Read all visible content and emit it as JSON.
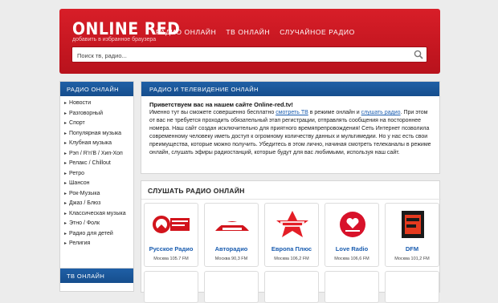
{
  "header": {
    "logo": "ONLINE RED",
    "logo_sub": "добавить в избранное браузера",
    "nav": [
      "РАДИО ОНЛАЙН",
      "ТВ ОНЛАЙН",
      "СЛУЧАЙНОЕ РАДИО"
    ],
    "search_placeholder": "Поиск тв, радио..."
  },
  "sidebar": {
    "title": "РАДИО ОНЛАЙН",
    "items": [
      "Новости",
      "Разговорный",
      "Спорт",
      "Популярная музыка",
      "Клубная музыка",
      "Рэп / R'n'B / Хип-Хоп",
      "Релакс / Chillout",
      "Ретро",
      "Шансон",
      "Рок-Музыка",
      "Джаз / Блюз",
      "Классическая музыка",
      "Этно / Фолк",
      "Радио для детей",
      "Религия"
    ],
    "title2": "ТВ ОНЛАЙН"
  },
  "intro": {
    "title": "РАДИО И ТЕЛЕВИДЕНИЕ ОНЛАЙН",
    "greeting": "Приветствуем вас на нашем сайте Online-red.tv!",
    "text1": "Именно тут вы сможете совершенно бесплатно ",
    "link1": "смотреть ТВ",
    "text2": " в режиме онлайн и ",
    "link2": "слушать радио",
    "text3": ". При этом от вас не требуется проходить обязательный этап регистрации, отправлять сообщения на постороннее номера. Наш сайт создан исключительно для приятного времяпрепровождения! Сеть Интернет позволила современному человеку иметь доступ к огромному количеству данных и мультимедии. Но у нас есть свои преимущества, которые можно получить. Убедитесь в этом лично, начиная смотреть телеканалы в режиме онлайн, слушать эфиры радиостанций, которые будут для вас любимыми, используя наш сайт."
  },
  "stations": {
    "title": "СЛУШАТЬ РАДИО ОНЛАЙН",
    "items": [
      {
        "name": "Русское Радио",
        "city": "Москва 105.7 FM",
        "logo": "РУССКОЕ РАДИО"
      },
      {
        "name": "Авторадио",
        "city": "Москва 90,3 FM",
        "logo": "АВТО РАДИО"
      },
      {
        "name": "Европа Плюс",
        "city": "Москва 106,2 FM",
        "logo": "Europa plus"
      },
      {
        "name": "Love Radio",
        "city": "Москва 106,6 FM",
        "logo": "LOVE RADIO"
      },
      {
        "name": "DFM",
        "city": "Москва 101,2 FM",
        "logo": "DFM"
      }
    ]
  },
  "colors": {
    "brand_red": "#c8161f",
    "nav_blue": "#1a5aa0",
    "link_blue": "#1a5db0"
  }
}
